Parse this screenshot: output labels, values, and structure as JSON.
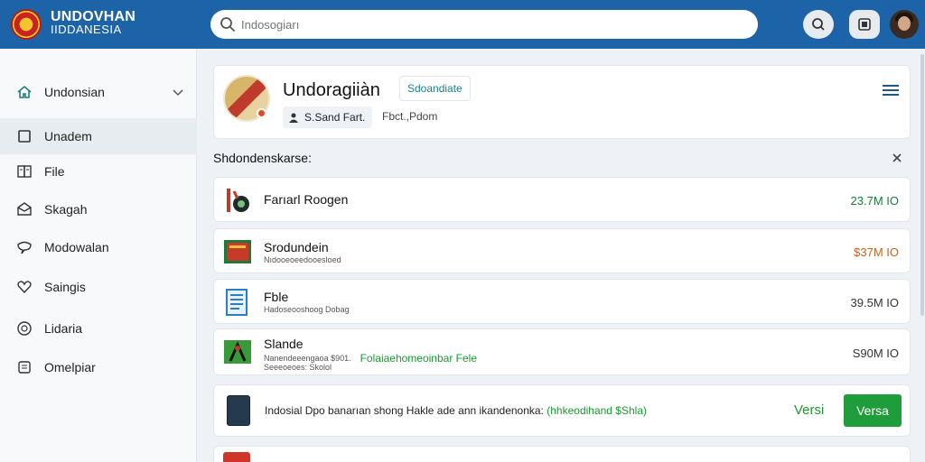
{
  "brand": {
    "line1": "UNDOVHAN",
    "line2": "IIDDANESIA"
  },
  "search": {
    "placeholder": "Indosogiarı"
  },
  "sidebar": {
    "items": [
      {
        "label": "Undonsian",
        "icon": "home-icon"
      },
      {
        "label": "Unadem",
        "icon": "square-icon"
      },
      {
        "label": "File",
        "icon": "files-icon"
      },
      {
        "label": "Skagah",
        "icon": "mail-icon"
      },
      {
        "label": "Modowalan",
        "icon": "chat-icon"
      },
      {
        "label": "Saingis",
        "icon": "heart-icon"
      },
      {
        "label": "Lidaria",
        "icon": "clock-icon"
      },
      {
        "label": "Omelpiar",
        "icon": "doc-icon"
      }
    ]
  },
  "profile": {
    "name": "Undoragiiàn",
    "chip": "Sdoandiate",
    "tag": "S.Sand Fart.",
    "sub": "Fbct.,Pdom"
  },
  "section": {
    "title": "Shdondenskarse:"
  },
  "files": [
    {
      "name": "Farıarl Roogen",
      "sub": "",
      "size": "23.7M IO",
      "size_color": "#1a7a3a"
    },
    {
      "name": "Srodundein",
      "sub": "Nıdooeoeedooesloed",
      "size": "$37M IO",
      "size_color": "#c2641e"
    },
    {
      "name": "Fble",
      "sub": "Hadoseooshoog Dobag",
      "size": "39.5M IO",
      "size_color": "#333333"
    },
    {
      "name": "Slande",
      "sub": "Nanendeeengaoa $901.",
      "link": "Folaiaehomeoinbar Fele",
      "sub2": "Seeeoeoes: Skolol",
      "size": "S90M IO",
      "size_color": "#333333"
    }
  ],
  "notice": {
    "text": "Indosial Dpo banarıan shong Hakle ade ann ikandenonka:",
    "highlight": "(hhkeodihand $Shla)",
    "link": "Versi",
    "button": "Versa"
  },
  "colors": {
    "topbar": "#1d63a8",
    "accent": "#1f9d3a"
  }
}
